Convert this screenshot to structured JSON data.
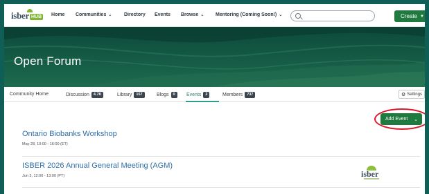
{
  "logo": {
    "text": "isber",
    "badge": "HUB"
  },
  "nav": {
    "items": [
      {
        "label": "Home",
        "dropdown": false
      },
      {
        "label": "Communities",
        "dropdown": true
      },
      {
        "label": "Directory",
        "dropdown": false
      },
      {
        "label": "Events",
        "dropdown": false
      },
      {
        "label": "Browse",
        "dropdown": true
      },
      {
        "label": "Mentoring (Coming Soon!)",
        "dropdown": true
      }
    ],
    "chevron": "⌄"
  },
  "search": {
    "placeholder": "",
    "value": "",
    "icon": "search-icon"
  },
  "create": {
    "label": "Create",
    "caret": "▼"
  },
  "banner": {
    "title": "Open Forum"
  },
  "tabs": [
    {
      "label": "Community Home",
      "badge": ""
    },
    {
      "label": "Discussion",
      "badge": "4.7K"
    },
    {
      "label": "Library",
      "badge": "157"
    },
    {
      "label": "Blogs",
      "badge": "0"
    },
    {
      "label": "Events",
      "badge": "2",
      "active": true
    },
    {
      "label": "Members",
      "badge": "737"
    }
  ],
  "settings": {
    "label": "Settings",
    "icon": "⚙"
  },
  "add_event": {
    "label": "Add Event",
    "chevron": "⌄"
  },
  "events": [
    {
      "title": "Ontario Biobanks Workshop",
      "time": "May 28, 10:00 - 16:00 (ET)"
    },
    {
      "title": "ISBER 2026 Annual General Meeting (AGM)",
      "time": "Jun 3, 12:00 - 13:00 (PT)"
    }
  ],
  "event_logo": {
    "text": "isber"
  },
  "colors": {
    "frame": "#0f5f57",
    "brand_green": "#1f7a3f",
    "link_blue": "#2d6fa8",
    "highlight": "#e1152a"
  }
}
